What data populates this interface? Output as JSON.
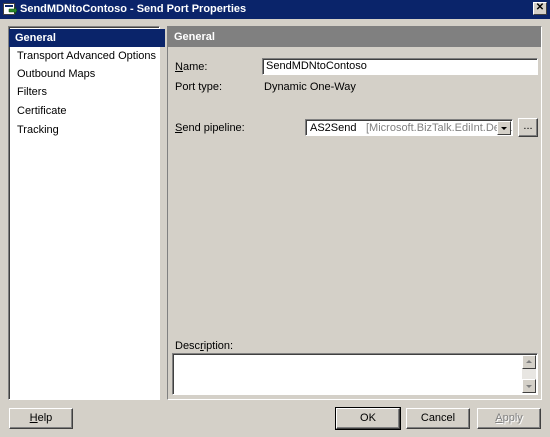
{
  "window": {
    "title": "SendMDNtoContoso - Send Port Properties",
    "close_glyph": "✕"
  },
  "nav": {
    "items": [
      {
        "label": "General",
        "selected": true
      },
      {
        "label": "Transport Advanced Options",
        "selected": false
      },
      {
        "label": "Outbound Maps",
        "selected": false
      },
      {
        "label": "Filters",
        "selected": false
      },
      {
        "label": "Certificate",
        "selected": false
      },
      {
        "label": "Tracking",
        "selected": false
      }
    ]
  },
  "general": {
    "header": "General",
    "name_label_u": "N",
    "name_label_rest": "ame:",
    "name_value": "SendMDNtoContoso",
    "port_type_label": "Port type:",
    "port_type_value": "Dynamic One-Way",
    "send_pipeline_label_u": "S",
    "send_pipeline_label_rest": "end pipeline:",
    "send_pipeline_value": "AS2Send",
    "send_pipeline_assembly": "[Microsoft.BizTalk.EdiInt.DefaultP",
    "browse_label": "...",
    "description_label_pre": "Desc",
    "description_label_u": "r",
    "description_label_post": "iption:",
    "description_value": ""
  },
  "buttons": {
    "help_u": "H",
    "help_rest": "elp",
    "ok": "OK",
    "cancel": "Cancel",
    "apply_u": "A",
    "apply_rest": "pply"
  },
  "colors": {
    "titlebar": "#0a246a",
    "selection": "#0a246a",
    "section_header": "#808080",
    "face": "#d4d0c8"
  }
}
